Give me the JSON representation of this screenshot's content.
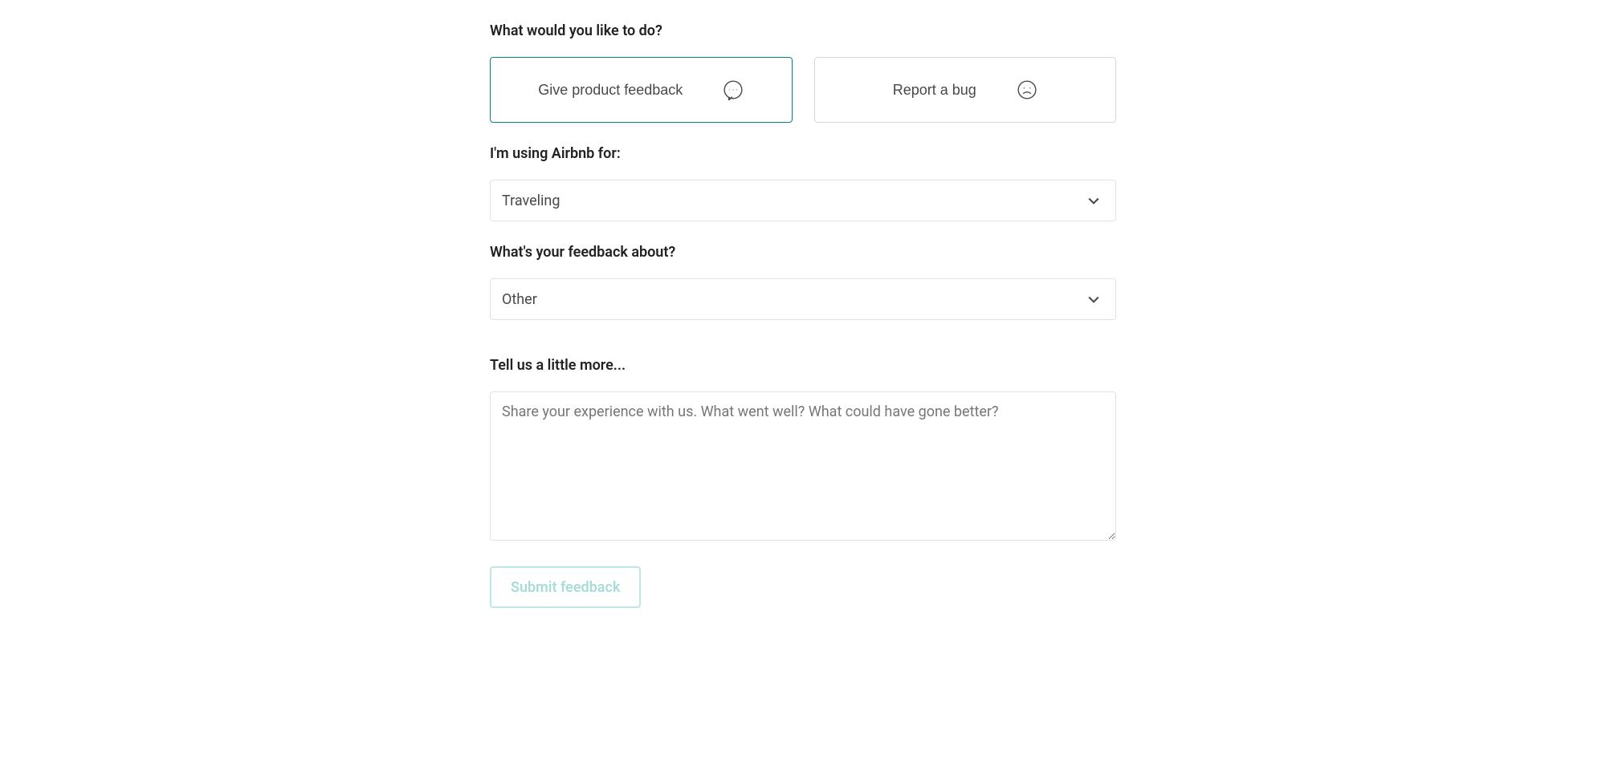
{
  "form": {
    "what_to_do_label": "What would you like to do?",
    "options": {
      "feedback_label": "Give product feedback",
      "bug_label": "Report a bug"
    },
    "using_for_label": "I'm using Airbnb for:",
    "using_for_value": "Traveling",
    "feedback_about_label": "What's your feedback about?",
    "feedback_about_value": "Other",
    "tell_more_label": "Tell us a little more...",
    "tell_more_placeholder": "Share your experience with us. What went well? What could have gone better?",
    "submit_label": "Submit feedback"
  }
}
